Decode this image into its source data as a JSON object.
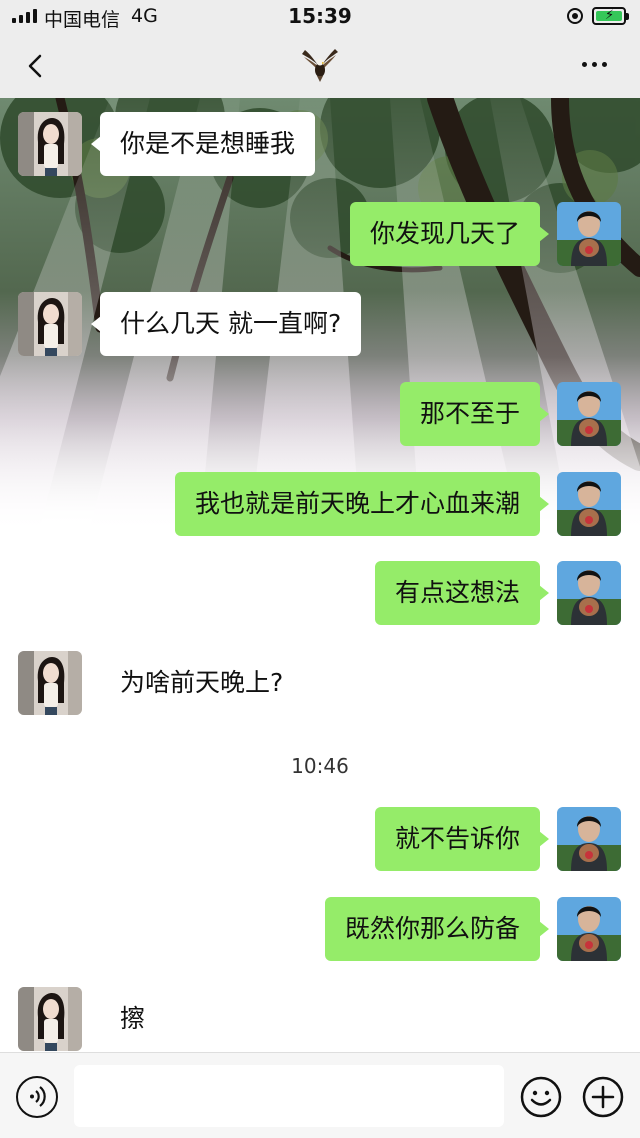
{
  "status_bar": {
    "carrier": "中国电信",
    "network": "4G",
    "time": "15:39",
    "icons": [
      "signal-icon",
      "orientation-lock-icon",
      "battery-charging-icon"
    ]
  },
  "nav_bar": {
    "icons": [
      "back-icon",
      "eagle-avatar-icon",
      "more-icon"
    ]
  },
  "messages": [
    {
      "side": "in",
      "text": "你是不是想睡我"
    },
    {
      "side": "out",
      "text": "你发现几天了"
    },
    {
      "side": "in",
      "text": "什么几天 就一直啊?"
    },
    {
      "side": "out",
      "text": "那不至于"
    },
    {
      "side": "out",
      "text": "我也就是前天晚上才心血来潮"
    },
    {
      "side": "out",
      "text": "有点这想法"
    },
    {
      "side": "in",
      "text": "为啥前天晚上?"
    },
    {
      "type": "time",
      "text": "10:46"
    },
    {
      "side": "out",
      "text": "就不告诉你"
    },
    {
      "side": "out",
      "text": "既然你那么防备"
    },
    {
      "side": "in",
      "text": "擦"
    }
  ],
  "input_bar": {
    "value": "",
    "icons": [
      "voice-icon",
      "emoji-icon",
      "plus-icon"
    ]
  },
  "colors": {
    "bar_bg": "#ededed",
    "bubble_out": "#95ec69",
    "bubble_in": "#ffffff",
    "battery": "#35c759"
  }
}
